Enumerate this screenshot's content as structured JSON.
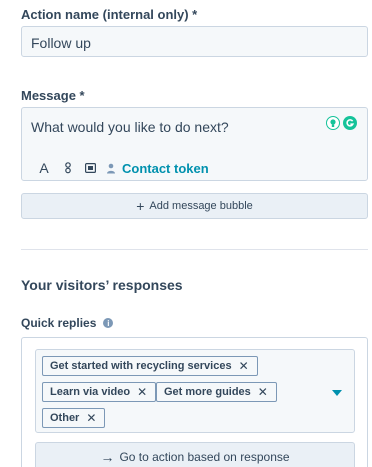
{
  "action_name": {
    "label": "Action name (internal only) *",
    "value": "Follow up"
  },
  "message": {
    "label": "Message *",
    "value": "What would you like to do next?",
    "toolbar": {
      "text_style_glyph": "A",
      "snippet_glyph": "8",
      "media_glyph": "▭",
      "contact_token_label": "Contact token"
    },
    "extension_icons": [
      "bulb-icon",
      "grammarly-icon"
    ]
  },
  "add_bubble_label": "Add message bubble",
  "responses_title": "Your visitors’ responses",
  "quick_replies": {
    "label": "Quick replies",
    "info_glyph": "i",
    "tags": [
      "Get started with recycling services",
      "Learn via video",
      "Get more guides",
      "Other"
    ],
    "remove_glyph": "✕",
    "goto_label": "Go to action based on response",
    "goto_arrow": "→"
  },
  "colors": {
    "accent": "#0091ae",
    "text": "#33475b",
    "border": "#cbd6e2",
    "field_bg": "#f5f8fa",
    "button_bg": "#eaf0f6",
    "grammarly": "#15c39a"
  }
}
